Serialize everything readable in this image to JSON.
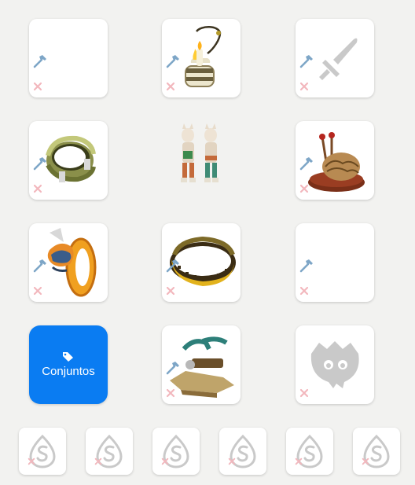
{
  "sets_button": {
    "label": "Conjuntos",
    "icon": "tags-icon"
  },
  "colors": {
    "accent": "#0a7cf2",
    "tool_icon": "#7ea6c7",
    "remove_icon": "#f2b7bd",
    "placeholder": "#c9c9c9"
  },
  "slots": [
    {
      "name": "weapon-slot",
      "item": "sword-placeholder-icon",
      "equipped": false
    },
    {
      "name": "amulet-slot",
      "item": "candle-amulet",
      "equipped": true
    },
    {
      "name": "shield-slot",
      "item": "sword-placeholder-icon",
      "equipped": false
    },
    {
      "name": "ring-left-slot",
      "item": "green-ring",
      "equipped": true
    },
    {
      "name": "character-preview",
      "item": "character-pair"
    },
    {
      "name": "hat-slot",
      "item": "nest-hat",
      "equipped": true
    },
    {
      "name": "ring-right-slot",
      "item": "orange-ring",
      "equipped": true
    },
    {
      "name": "belt-slot",
      "item": "studded-belt",
      "equipped": true
    },
    {
      "name": "cape-slot",
      "item": "empty",
      "equipped": false
    },
    {
      "name": "boots-slot",
      "item": "wooden-boots",
      "equipped": true
    },
    {
      "name": "pet-slot",
      "item": "pet-placeholder-icon",
      "equipped": false
    }
  ],
  "dofus_slots": [
    {
      "item": "dofus-placeholder-icon"
    },
    {
      "item": "dofus-placeholder-icon"
    },
    {
      "item": "dofus-placeholder-icon"
    },
    {
      "item": "dofus-placeholder-icon"
    },
    {
      "item": "dofus-placeholder-icon"
    },
    {
      "item": "dofus-placeholder-icon"
    }
  ]
}
